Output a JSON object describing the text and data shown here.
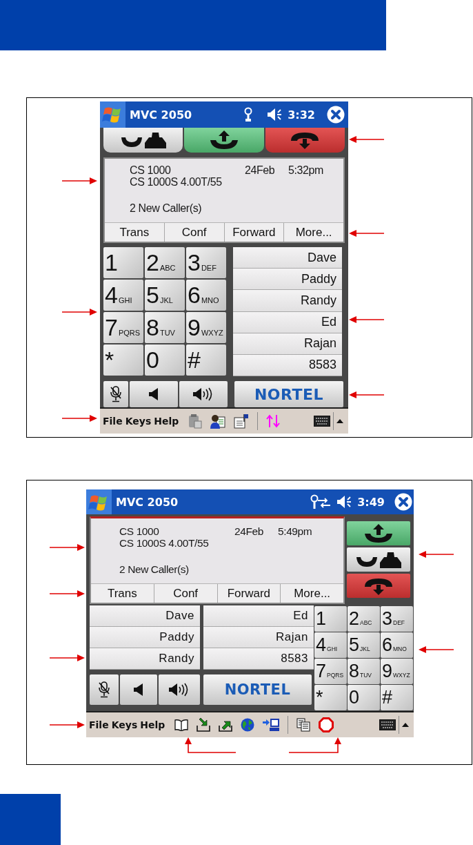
{
  "figures": [
    {
      "kind": "portrait",
      "screen": {
        "title": "MVC 2050",
        "clock": "3:32",
        "call_buttons": [
          {
            "kind": "handset"
          },
          {
            "kind": "answer"
          },
          {
            "kind": "release"
          }
        ],
        "info": {
          "system": "CS 1000",
          "date": "24Feb",
          "time": "5:32pm",
          "version": "CS 1000S 4.00T/55",
          "status": "2 New Caller(s)"
        },
        "softkeys": [
          "Trans",
          "Conf",
          "Forward",
          "More..."
        ],
        "keypad": [
          {
            "digit": "1"
          },
          {
            "digit": "2",
            "letters": "ABC"
          },
          {
            "digit": "3",
            "letters": "DEF"
          },
          {
            "digit": "4",
            "letters": "GHI"
          },
          {
            "digit": "5",
            "letters": "JKL"
          },
          {
            "digit": "6",
            "letters": "MNO"
          },
          {
            "digit": "7",
            "letters": "PQRS"
          },
          {
            "digit": "8",
            "letters": "TUV"
          },
          {
            "digit": "9",
            "letters": "WXYZ"
          },
          {
            "digit": "*"
          },
          {
            "digit": "0"
          },
          {
            "digit": "#"
          }
        ],
        "speed_dial": [
          "Dave",
          "Paddy",
          "Randy",
          "Ed",
          "Rajan",
          "8583"
        ],
        "logo": "NORTEL",
        "menus": [
          "File",
          "Keys",
          "Help"
        ]
      }
    },
    {
      "kind": "landscape",
      "screen": {
        "title": "MVC 2050",
        "clock": "3:49",
        "call_buttons": [
          {
            "kind": "answer"
          },
          {
            "kind": "handset"
          },
          {
            "kind": "release"
          }
        ],
        "info": {
          "system": "CS 1000",
          "date": "24Feb",
          "time": "5:49pm",
          "version": "CS 1000S 4.00T/55",
          "status": "2 New Caller(s)"
        },
        "softkeys": [
          "Trans",
          "Conf",
          "Forward",
          "More..."
        ],
        "keypad": [
          {
            "digit": "1"
          },
          {
            "digit": "2",
            "letters": "ABC"
          },
          {
            "digit": "3",
            "letters": "DEF"
          },
          {
            "digit": "4",
            "letters": "GHI"
          },
          {
            "digit": "5",
            "letters": "JKL"
          },
          {
            "digit": "6",
            "letters": "MNO"
          },
          {
            "digit": "7",
            "letters": "PQRS"
          },
          {
            "digit": "8",
            "letters": "TUV"
          },
          {
            "digit": "9",
            "letters": "WXYZ"
          },
          {
            "digit": "*"
          },
          {
            "digit": "0"
          },
          {
            "digit": "#"
          }
        ],
        "speed_dial": [
          "Dave",
          "Paddy",
          "Randy",
          "Ed",
          "Rajan",
          "8583"
        ],
        "logo": "NORTEL",
        "menus": [
          "File",
          "Keys",
          "Help"
        ]
      }
    }
  ]
}
